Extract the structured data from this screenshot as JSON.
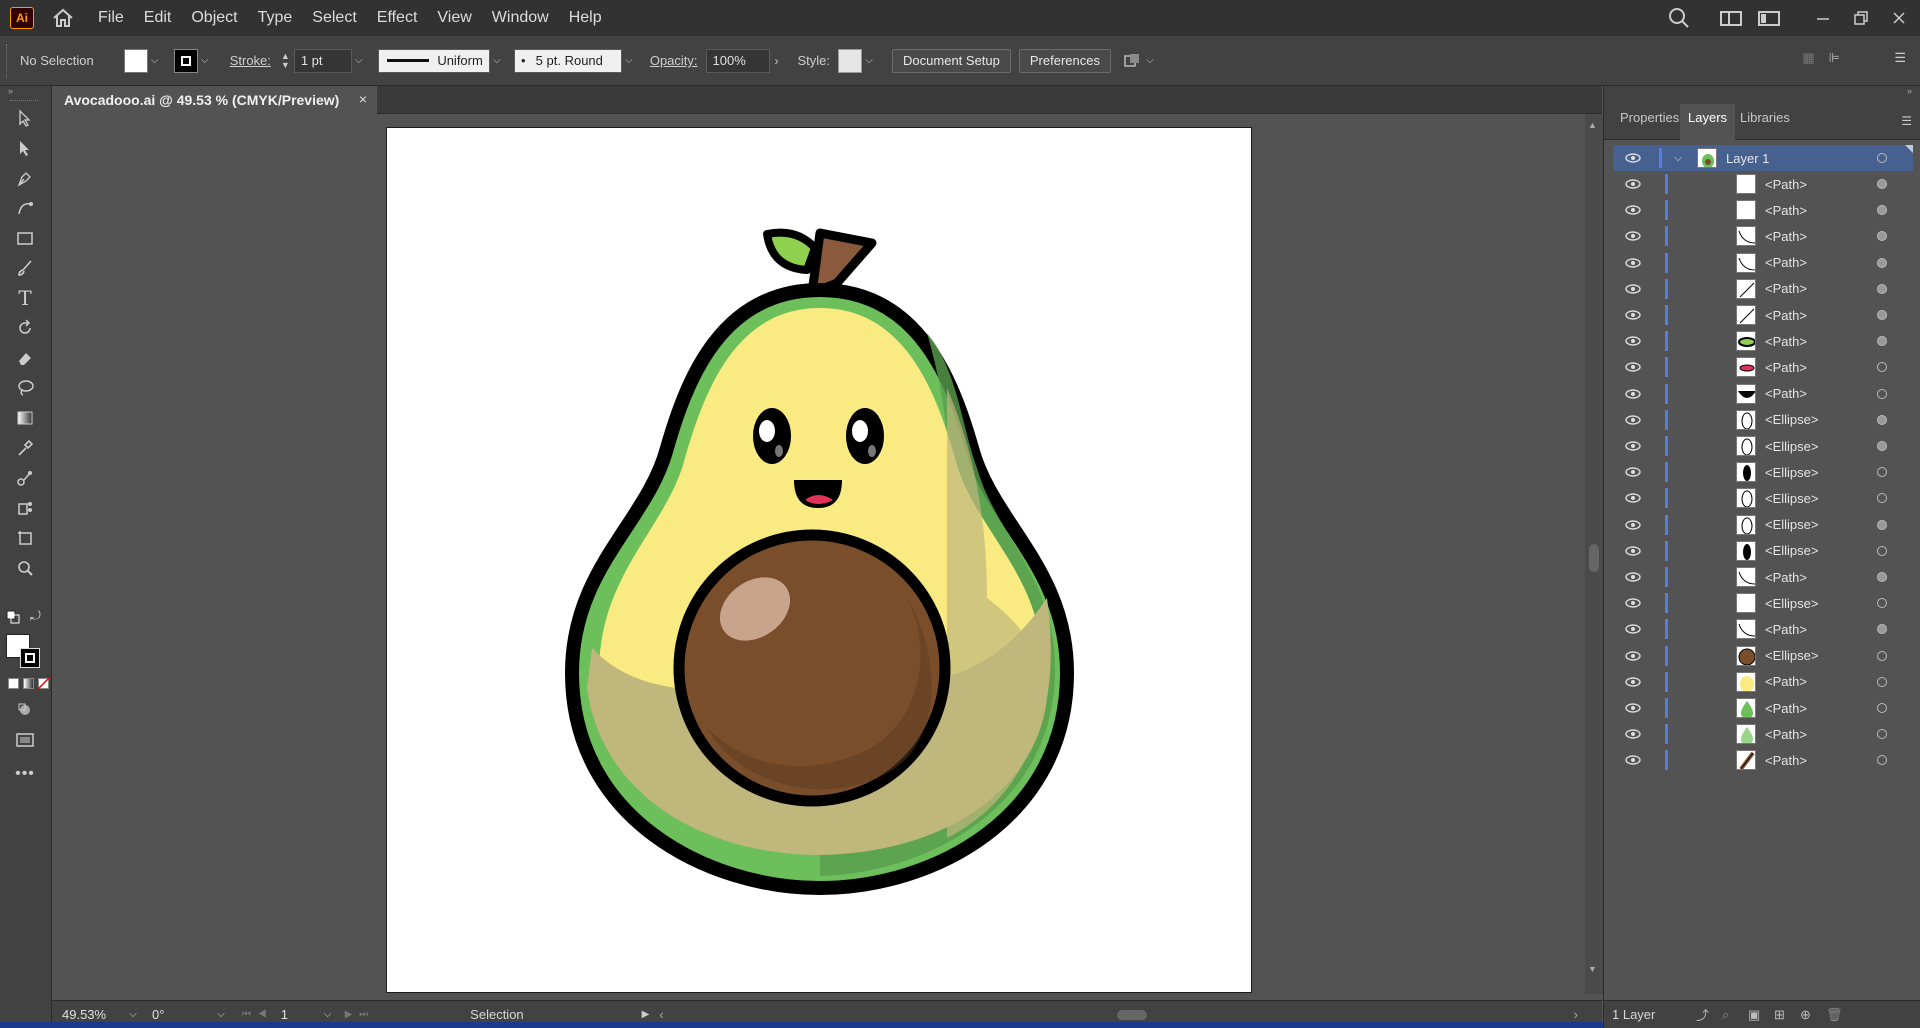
{
  "menubar": {
    "app_logo": "Ai",
    "items": [
      "File",
      "Edit",
      "Object",
      "Type",
      "Select",
      "Effect",
      "View",
      "Window",
      "Help"
    ]
  },
  "control": {
    "selection": "No Selection",
    "stroke_label": "Stroke:",
    "stroke_value": "1 pt",
    "profile": "Uniform",
    "brush": "5 pt. Round",
    "opacity_label": "Opacity:",
    "opacity_value": "100%",
    "style_label": "Style:",
    "doc_setup": "Document Setup",
    "preferences": "Preferences"
  },
  "document": {
    "tab_title": "Avocadooo.ai @ 49.53 % (CMYK/Preview)",
    "close": "×"
  },
  "status": {
    "zoom": "49.53%",
    "rotation": "0°",
    "artboard": "1",
    "tool": "Selection"
  },
  "panel": {
    "tabs": [
      "Properties",
      "Layers",
      "Libraries"
    ],
    "active_tab": "Layers",
    "layer_name": "Layer 1",
    "sublayers": [
      "<Path>",
      "<Path>",
      "<Path>",
      "<Path>",
      "<Path>",
      "<Path>",
      "<Path>",
      "<Path>",
      "<Path>",
      "<Ellipse>",
      "<Ellipse>",
      "<Ellipse>",
      "<Ellipse>",
      "<Ellipse>",
      "<Ellipse>",
      "<Path>",
      "<Ellipse>",
      "<Path>",
      "<Ellipse>",
      "<Path>",
      "<Path>",
      "<Path>",
      "<Path>"
    ],
    "footer": "1 Layer"
  },
  "colors": {
    "accent": "#4f7fe0",
    "avocado_dark": "#5fa84e",
    "avocado_flesh": "#f9ea82",
    "pit": "#7a4e2b"
  }
}
